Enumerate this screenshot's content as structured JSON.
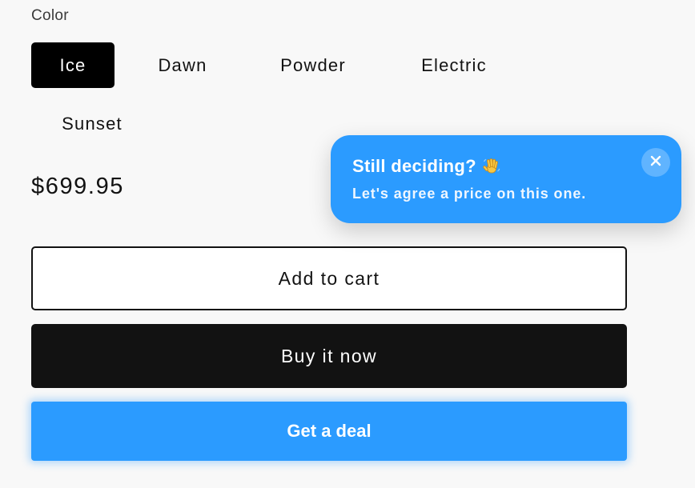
{
  "product": {
    "color_label": "Color",
    "colors": [
      {
        "label": "Ice",
        "selected": true
      },
      {
        "label": "Dawn",
        "selected": false
      },
      {
        "label": "Powder",
        "selected": false
      },
      {
        "label": "Electric",
        "selected": false
      },
      {
        "label": "Sunset",
        "selected": false
      }
    ],
    "price": "$699.95"
  },
  "actions": {
    "add_to_cart": "Add to cart",
    "buy_now": "Buy it now",
    "get_deal": "Get a deal"
  },
  "popup": {
    "title": "Still deciding?",
    "title_icon": "waving-hand-icon",
    "message": "Let's agree a price on this one.",
    "close_icon": "close-icon"
  },
  "colors": {
    "accent": "#2b9bff",
    "dark": "#121212",
    "background": "#f8f8f8"
  }
}
